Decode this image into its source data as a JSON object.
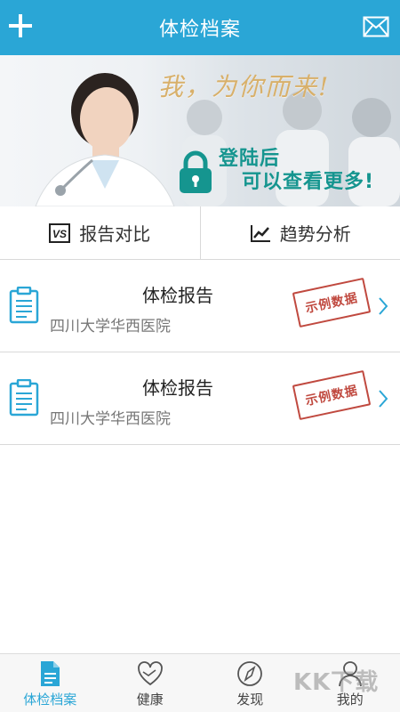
{
  "header": {
    "title": "体检档案",
    "add_icon": "plus-icon",
    "mail_icon": "mail-icon"
  },
  "banner": {
    "slogan": "我，为你而来!",
    "line1": "登陆后",
    "line2": "可以查看更多!"
  },
  "actions": [
    {
      "label": "报告对比",
      "icon": "vs-icon"
    },
    {
      "label": "趋势分析",
      "icon": "trend-chart-icon"
    }
  ],
  "reports": [
    {
      "title": "体检报告",
      "hospital": "四川大学华西医院",
      "stamp": "示例数据"
    },
    {
      "title": "体检报告",
      "hospital": "四川大学华西医院",
      "stamp": "示例数据"
    }
  ],
  "tabs": [
    {
      "label": "体检档案",
      "icon": "document-icon",
      "active": true
    },
    {
      "label": "健康",
      "icon": "heart-hands-icon",
      "active": false
    },
    {
      "label": "发现",
      "icon": "compass-icon",
      "active": false
    },
    {
      "label": "我的",
      "icon": "user-icon",
      "active": false
    }
  ],
  "watermark": "KK下载",
  "colors": {
    "primary": "#2aa6d6",
    "banner_text": "#15958f",
    "stamp": "#c0493f"
  }
}
